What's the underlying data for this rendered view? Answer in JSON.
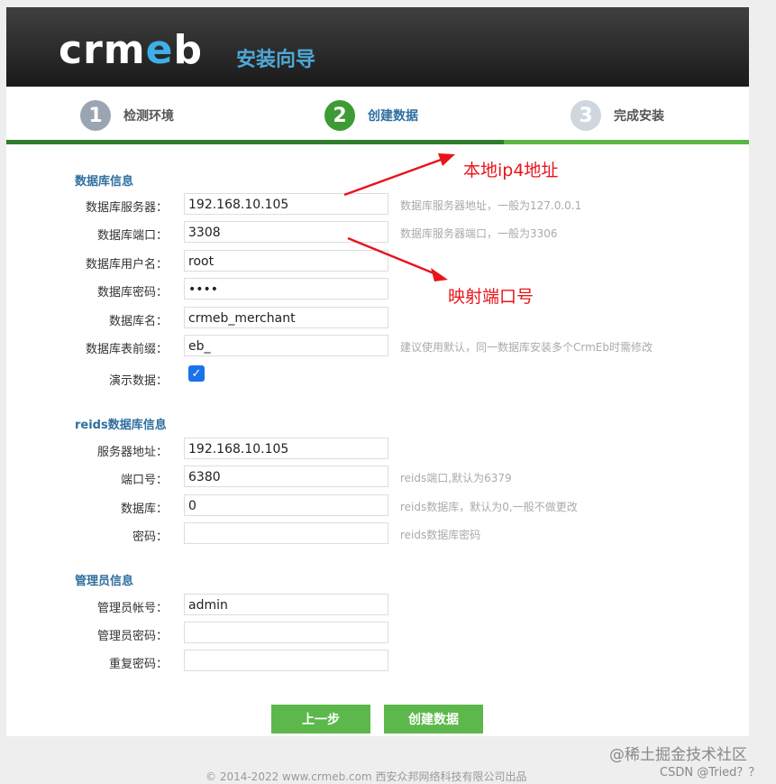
{
  "header": {
    "logo": "crmeb",
    "title": "安装向导"
  },
  "steps": [
    {
      "num": "1",
      "label": "检测环境",
      "color": "#9aa5b1"
    },
    {
      "num": "2",
      "label": "创建数据",
      "color": "#3d9b35"
    },
    {
      "num": "3",
      "label": "完成安装",
      "color": "#cfd6dd"
    }
  ],
  "progress": 0.67,
  "db": {
    "title": "数据库信息",
    "fields": [
      {
        "label": "数据库服务器：",
        "value": "192.168.10.105",
        "hint": "数据库服务器地址，一般为127.0.0.1"
      },
      {
        "label": "数据库端口：",
        "value": "3308",
        "hint": "数据库服务器端口，一般为3306"
      },
      {
        "label": "数据库用户名：",
        "value": "root",
        "hint": ""
      },
      {
        "label": "数据库密码：",
        "value": "••••",
        "hint": ""
      },
      {
        "label": "数据库名：",
        "value": "crmeb_merchant",
        "hint": ""
      },
      {
        "label": "数据库表前缀：",
        "value": "eb_",
        "hint": "建议使用默认，同一数据库安装多个CrmEb时需修改"
      }
    ],
    "demo_label": "演示数据：",
    "demo_checked": "✓"
  },
  "redis": {
    "title": "reids数据库信息",
    "fields": [
      {
        "label": "服务器地址：",
        "value": "192.168.10.105",
        "hint": ""
      },
      {
        "label": "端口号：",
        "value": "6380",
        "hint": "reids端口,默认为6379"
      },
      {
        "label": "数据库：",
        "value": "0",
        "hint": "reids数据库，默认为0,一般不做更改"
      },
      {
        "label": "密码：",
        "value": "",
        "hint": "reids数据库密码"
      }
    ]
  },
  "admin": {
    "title": "管理员信息",
    "fields": [
      {
        "label": "管理员帐号：",
        "value": "admin"
      },
      {
        "label": "管理员密码：",
        "value": ""
      },
      {
        "label": "重复密码：",
        "value": ""
      }
    ]
  },
  "buttons": {
    "prev": "上一步",
    "create": "创建数据"
  },
  "footer": "© 2014-2022 www.crmeb.com 西安众邦网络科技有限公司出品",
  "annotations": {
    "ip": "本地ip4地址",
    "port": "映射端口号",
    "color": "#e8141c"
  },
  "watermarks": {
    "juejin": "@稀土掘金技术社区",
    "csdn": "CSDN @Tried？？"
  }
}
